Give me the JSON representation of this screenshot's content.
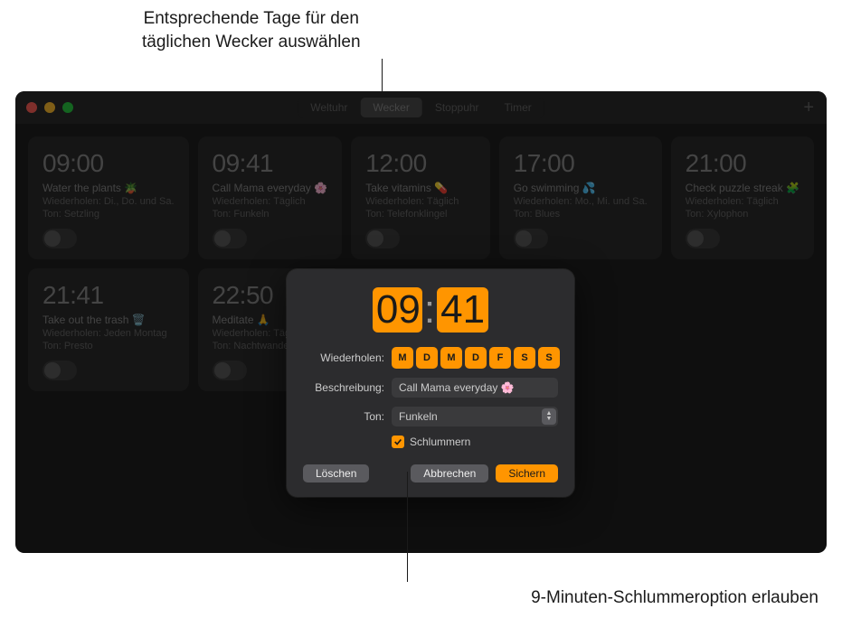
{
  "callouts": {
    "top_line1": "Entsprechende Tage für den",
    "top_line2": "täglichen Wecker auswählen",
    "bottom": "9-Minuten-Schlummeroption erlauben"
  },
  "tabs": {
    "worldclock": "Weltuhr",
    "alarm": "Wecker",
    "stopwatch": "Stoppuhr",
    "timer": "Timer"
  },
  "add_icon": "+",
  "alarms": [
    {
      "time": "09:00",
      "label": "Water the plants 🪴",
      "repeat": "Wiederholen: Di., Do. und Sa.",
      "tone": "Ton: Setzling"
    },
    {
      "time": "09:41",
      "label": "Call Mama everyday 🌸",
      "repeat": "Wiederholen: Täglich",
      "tone": "Ton: Funkeln"
    },
    {
      "time": "12:00",
      "label": "Take vitamins 💊",
      "repeat": "Wiederholen: Täglich",
      "tone": "Ton: Telefonklingel"
    },
    {
      "time": "17:00",
      "label": "Go swimming 💦",
      "repeat": "Wiederholen: Mo., Mi. und Sa.",
      "tone": "Ton: Blues"
    },
    {
      "time": "21:00",
      "label": "Check puzzle streak 🧩",
      "repeat": "Wiederholen: Täglich",
      "tone": "Ton: Xylophon"
    },
    {
      "time": "21:41",
      "label": "Take out the trash 🗑️",
      "repeat": "Wiederholen: Jeden Montag",
      "tone": "Ton: Presto"
    },
    {
      "time": "22:50",
      "label": "Meditate 🙏",
      "repeat": "Wiederholen: Täglich",
      "tone": "Ton: Nachtwanderung"
    }
  ],
  "edit": {
    "hours": "09",
    "minutes": "41",
    "colon": ":",
    "repeat_label": "Wiederholen:",
    "days": [
      "M",
      "D",
      "M",
      "D",
      "F",
      "S",
      "S"
    ],
    "desc_label": "Beschreibung:",
    "desc_value": "Call Mama everyday 🌸",
    "tone_label": "Ton:",
    "tone_value": "Funkeln",
    "snooze_label": "Schlummern",
    "delete": "Löschen",
    "cancel": "Abbrechen",
    "save": "Sichern"
  }
}
